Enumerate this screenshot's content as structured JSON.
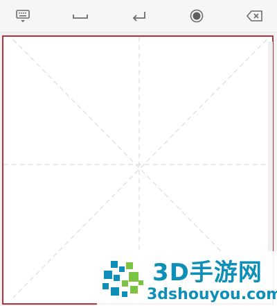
{
  "toolbar": {
    "icons": [
      "keyboard-icon",
      "space-icon",
      "enter-icon",
      "record-icon",
      "backspace-icon"
    ],
    "icon_color": "#6b6b6b"
  },
  "writing_pad": {
    "border_color": "#b8303a",
    "guide_color": "#d6d6d6",
    "guide_style": "dashed",
    "guides": [
      "horizontal-center",
      "vertical-center",
      "diagonal",
      "anti-diagonal"
    ]
  },
  "watermark": {
    "title": "3D手游网",
    "url": "3dshouyou.com",
    "colors": {
      "blue": "#0f8fb8",
      "green": "#7cc243"
    }
  }
}
